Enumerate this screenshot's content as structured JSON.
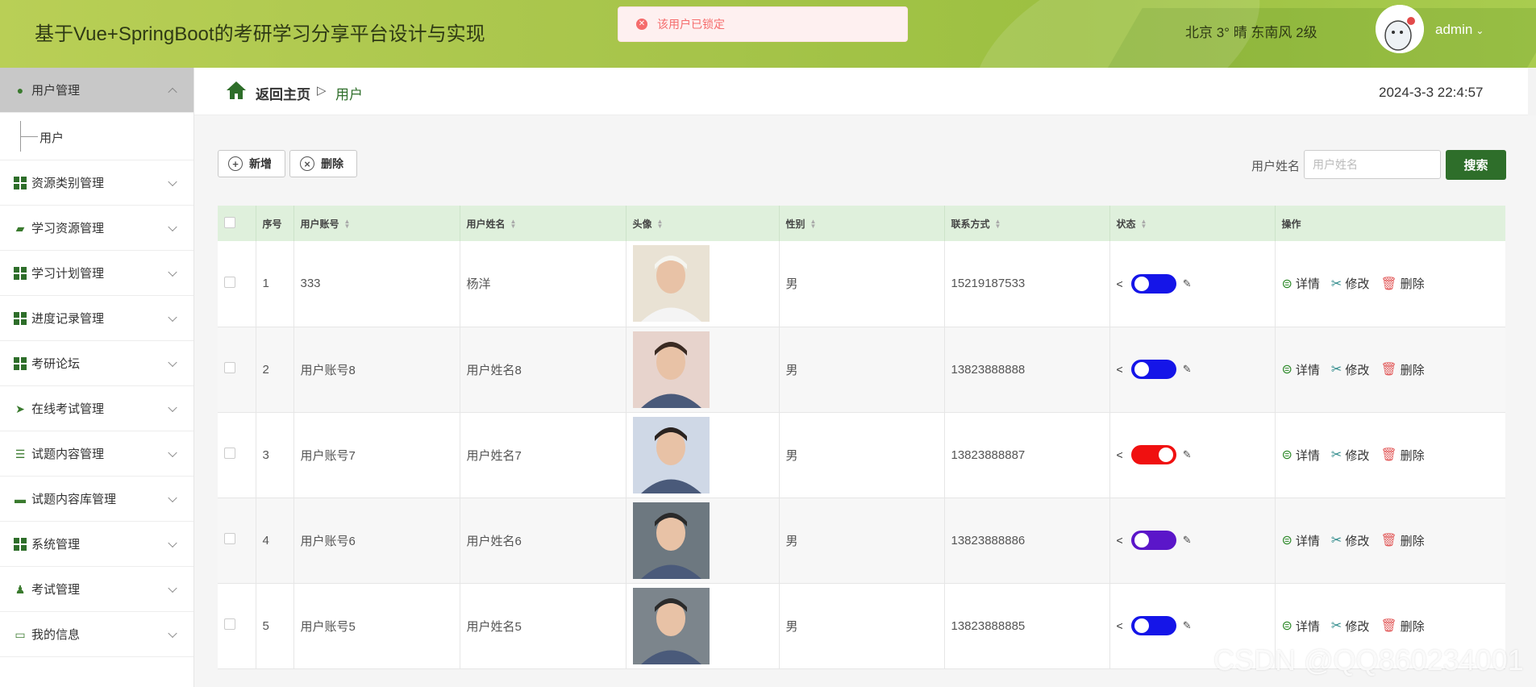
{
  "header": {
    "app_title": "基于Vue+SpringBoot的考研学习分享平台设计与实现",
    "toast_message": "该用户已锁定",
    "weather": "北京  3°  晴  东南风  2级",
    "user": "admin"
  },
  "sidebar": {
    "items": [
      {
        "label": "用户管理",
        "icon": "leaf-icon",
        "active": true,
        "sub": [
          "用户"
        ]
      },
      {
        "label": "资源类别管理",
        "icon": "grid-icon"
      },
      {
        "label": "学习资源管理",
        "icon": "wallet-icon"
      },
      {
        "label": "学习计划管理",
        "icon": "grid-icon"
      },
      {
        "label": "进度记录管理",
        "icon": "grid-icon"
      },
      {
        "label": "考研论坛",
        "icon": "grid-icon"
      },
      {
        "label": "在线考试管理",
        "icon": "send-icon"
      },
      {
        "label": "试题内容管理",
        "icon": "sliders-icon"
      },
      {
        "label": "试题内容库管理",
        "icon": "monitor-icon"
      },
      {
        "label": "系统管理",
        "icon": "grid-icon"
      },
      {
        "label": "考试管理",
        "icon": "person-icon"
      },
      {
        "label": "我的信息",
        "icon": "card-icon"
      }
    ]
  },
  "breadcrumb": {
    "home": "返回主页",
    "current": "用户"
  },
  "datetime": "2024-3-3 22:4:57",
  "toolbar": {
    "add": "新增",
    "delete": "删除"
  },
  "search": {
    "label": "用户姓名",
    "placeholder": "用户姓名",
    "button": "搜索"
  },
  "table": {
    "columns": [
      "序号",
      "用户账号",
      "用户姓名",
      "头像",
      "性别",
      "联系方式",
      "状态",
      "操作"
    ],
    "rows": [
      {
        "no": "1",
        "account": "333",
        "name": "杨洋",
        "gender": "男",
        "phone": "15219187533",
        "status_color": "#1515e8",
        "locked": false
      },
      {
        "no": "2",
        "account": "用户账号8",
        "name": "用户姓名8",
        "gender": "男",
        "phone": "13823888888",
        "status_color": "#1515e8",
        "locked": false
      },
      {
        "no": "3",
        "account": "用户账号7",
        "name": "用户姓名7",
        "gender": "男",
        "phone": "13823888887",
        "status_color": "#f01010",
        "locked": true
      },
      {
        "no": "4",
        "account": "用户账号6",
        "name": "用户姓名6",
        "gender": "男",
        "phone": "13823888886",
        "status_color": "#5b16c9",
        "locked": false
      },
      {
        "no": "5",
        "account": "用户账号5",
        "name": "用户姓名5",
        "gender": "男",
        "phone": "13823888885",
        "status_color": "#1515e8",
        "locked": false
      }
    ],
    "actions": {
      "detail": "详情",
      "edit": "修改",
      "delete": "删除"
    }
  },
  "watermark": "CSDN @QQ860234001"
}
